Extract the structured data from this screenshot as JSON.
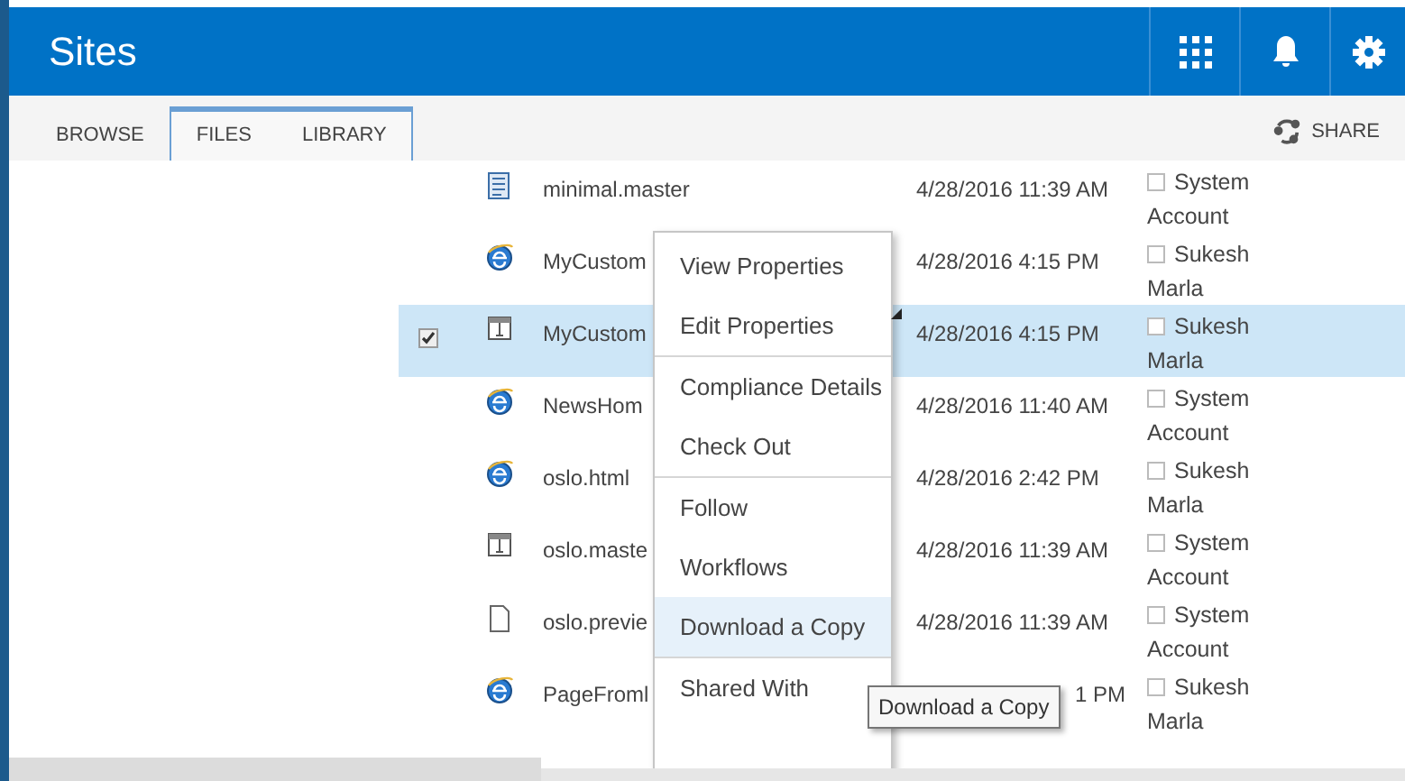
{
  "header": {
    "title": "Sites"
  },
  "tabs": [
    {
      "label": "BROWSE",
      "selected": false,
      "contextual": false
    },
    {
      "label": "FILES",
      "selected": false,
      "contextual": true
    },
    {
      "label": "LIBRARY",
      "selected": false,
      "contextual": true
    }
  ],
  "share": {
    "label": "SHARE"
  },
  "rows": [
    {
      "kind": "page",
      "name": "minimal.master",
      "date": "4/28/2016 11:39 AM",
      "modified_by": "System Account",
      "selected": false,
      "partly_covered": false
    },
    {
      "kind": "web",
      "name": "MyCustom",
      "date": "4/28/2016 4:15 PM",
      "modified_by": "Sukesh Marla",
      "selected": false,
      "partly_covered": false
    },
    {
      "kind": "master",
      "name": "MyCustom",
      "date": "4/28/2016 4:15 PM",
      "modified_by": "Sukesh Marla",
      "selected": true,
      "partly_covered": false
    },
    {
      "kind": "web",
      "name": "NewsHom",
      "date": "4/28/2016 11:40 AM",
      "modified_by": "System Account",
      "selected": false,
      "partly_covered": false
    },
    {
      "kind": "web",
      "name": "oslo.html",
      "date": "4/28/2016 2:42 PM",
      "modified_by": "Sukesh Marla",
      "selected": false,
      "partly_covered": false
    },
    {
      "kind": "master",
      "name": "oslo.maste",
      "date": "4/28/2016 11:39 AM",
      "modified_by": "System Account",
      "selected": false,
      "partly_covered": false
    },
    {
      "kind": "blank",
      "name": "oslo.previe",
      "date": "4/28/2016 11:39 AM",
      "modified_by": "System Account",
      "selected": false,
      "partly_covered": false
    },
    {
      "kind": "web",
      "name": "PageFroml",
      "date": "1 PM",
      "modified_by": "Sukesh Marla",
      "selected": false,
      "partly_covered": true
    }
  ],
  "menu": [
    {
      "label": "View Properties",
      "selected": false,
      "separator_before": false
    },
    {
      "label": "Edit Properties",
      "selected": false,
      "separator_before": false
    },
    {
      "label": "Compliance Details",
      "selected": false,
      "separator_before": true
    },
    {
      "label": "Check Out",
      "selected": false,
      "separator_before": false
    },
    {
      "label": "Follow",
      "selected": false,
      "separator_before": true
    },
    {
      "label": "Workflows",
      "selected": false,
      "separator_before": false
    },
    {
      "label": "Download a Copy",
      "selected": true,
      "separator_before": false
    },
    {
      "label": "Shared With",
      "selected": false,
      "separator_before": true
    }
  ],
  "tooltip": "Download a Copy"
}
